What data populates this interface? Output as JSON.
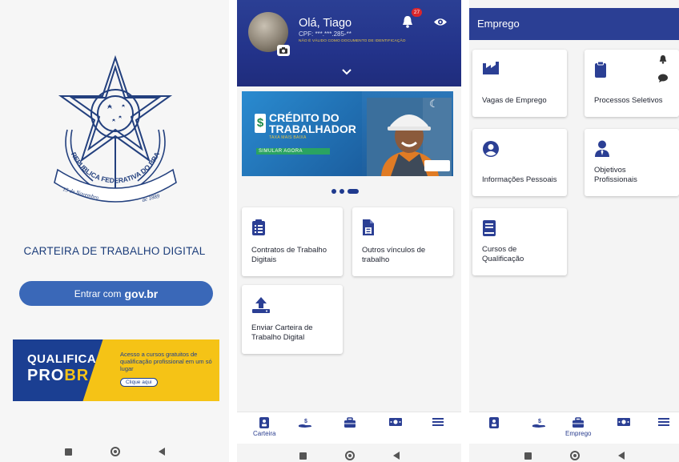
{
  "screen1": {
    "title": "CARTEIRA DE TRABALHO DIGITAL",
    "login_button_prefix": "Entrar com",
    "login_button_brand": "gov.br",
    "emblem_motto_arc": "REPUBLICA FEDERATIVA DO BRASIL",
    "emblem_date_left": "15 de Novembro",
    "emblem_date_right": "de 1889",
    "banner": {
      "brand_line1": "QUALIFICA",
      "brand_line2_a": "PRO",
      "brand_line2_b": "BR",
      "text": "Acesso a cursos gratuitos de qualificação profissional em um só lugar",
      "cta": "Clique aqui"
    }
  },
  "screen2": {
    "greeting": "Olá, Tiago",
    "cpf": "CPF: ***.***.285-**",
    "id_warning": "NÃO É VÁLIDO COMO DOCUMENTO DE IDENTIFICAÇÃO",
    "notification_count": "27",
    "banner": {
      "title_line1": "CRÉDITO DO",
      "title_line2": "TRABALHADOR",
      "subtitle": "TAXA MAIS BAIXA",
      "cta": "SIMULAR AGORA"
    },
    "cards": [
      {
        "label": "Contratos de Trabalho Digitais",
        "icon": "clipboard-list-icon"
      },
      {
        "label": "Outros vínculos de trabalho",
        "icon": "document-icon"
      },
      {
        "label": "Enviar Carteira de Trabalho Digital",
        "icon": "upload-icon"
      }
    ],
    "tabs": [
      {
        "label": "Carteira",
        "icon": "id-badge-icon",
        "active": true
      },
      {
        "label": "",
        "icon": "hand-money-icon"
      },
      {
        "label": "",
        "icon": "briefcase-icon"
      },
      {
        "label": "",
        "icon": "banknote-icon"
      },
      {
        "label": "",
        "icon": "menu-icon"
      }
    ]
  },
  "screen3": {
    "title": "Emprego",
    "cards": [
      {
        "label": "Vagas de Emprego",
        "icon": "factory-icon"
      },
      {
        "label": "Processos Seletivos",
        "icon": "clipboard-icon"
      },
      {
        "label": "Informações Pessoais",
        "icon": "person-circle-icon"
      },
      {
        "label": "Objetivos Profissionais",
        "icon": "user-tie-icon"
      },
      {
        "label": "Cursos de Qualificação",
        "icon": "book-icon"
      }
    ],
    "tabs": [
      {
        "label": "",
        "icon": "id-badge-icon"
      },
      {
        "label": "",
        "icon": "hand-money-icon"
      },
      {
        "label": "Emprego",
        "icon": "briefcase-icon",
        "active": true
      },
      {
        "label": "",
        "icon": "banknote-icon"
      },
      {
        "label": "",
        "icon": "menu-icon"
      }
    ]
  },
  "colors": {
    "primary": "#2b3f94",
    "title_blue": "#1c3d7a",
    "govbr_button": "#3a68b8",
    "badge_red": "#d9262c",
    "qualifica_yellow": "#f5c316",
    "credit_green": "#2aa361"
  }
}
